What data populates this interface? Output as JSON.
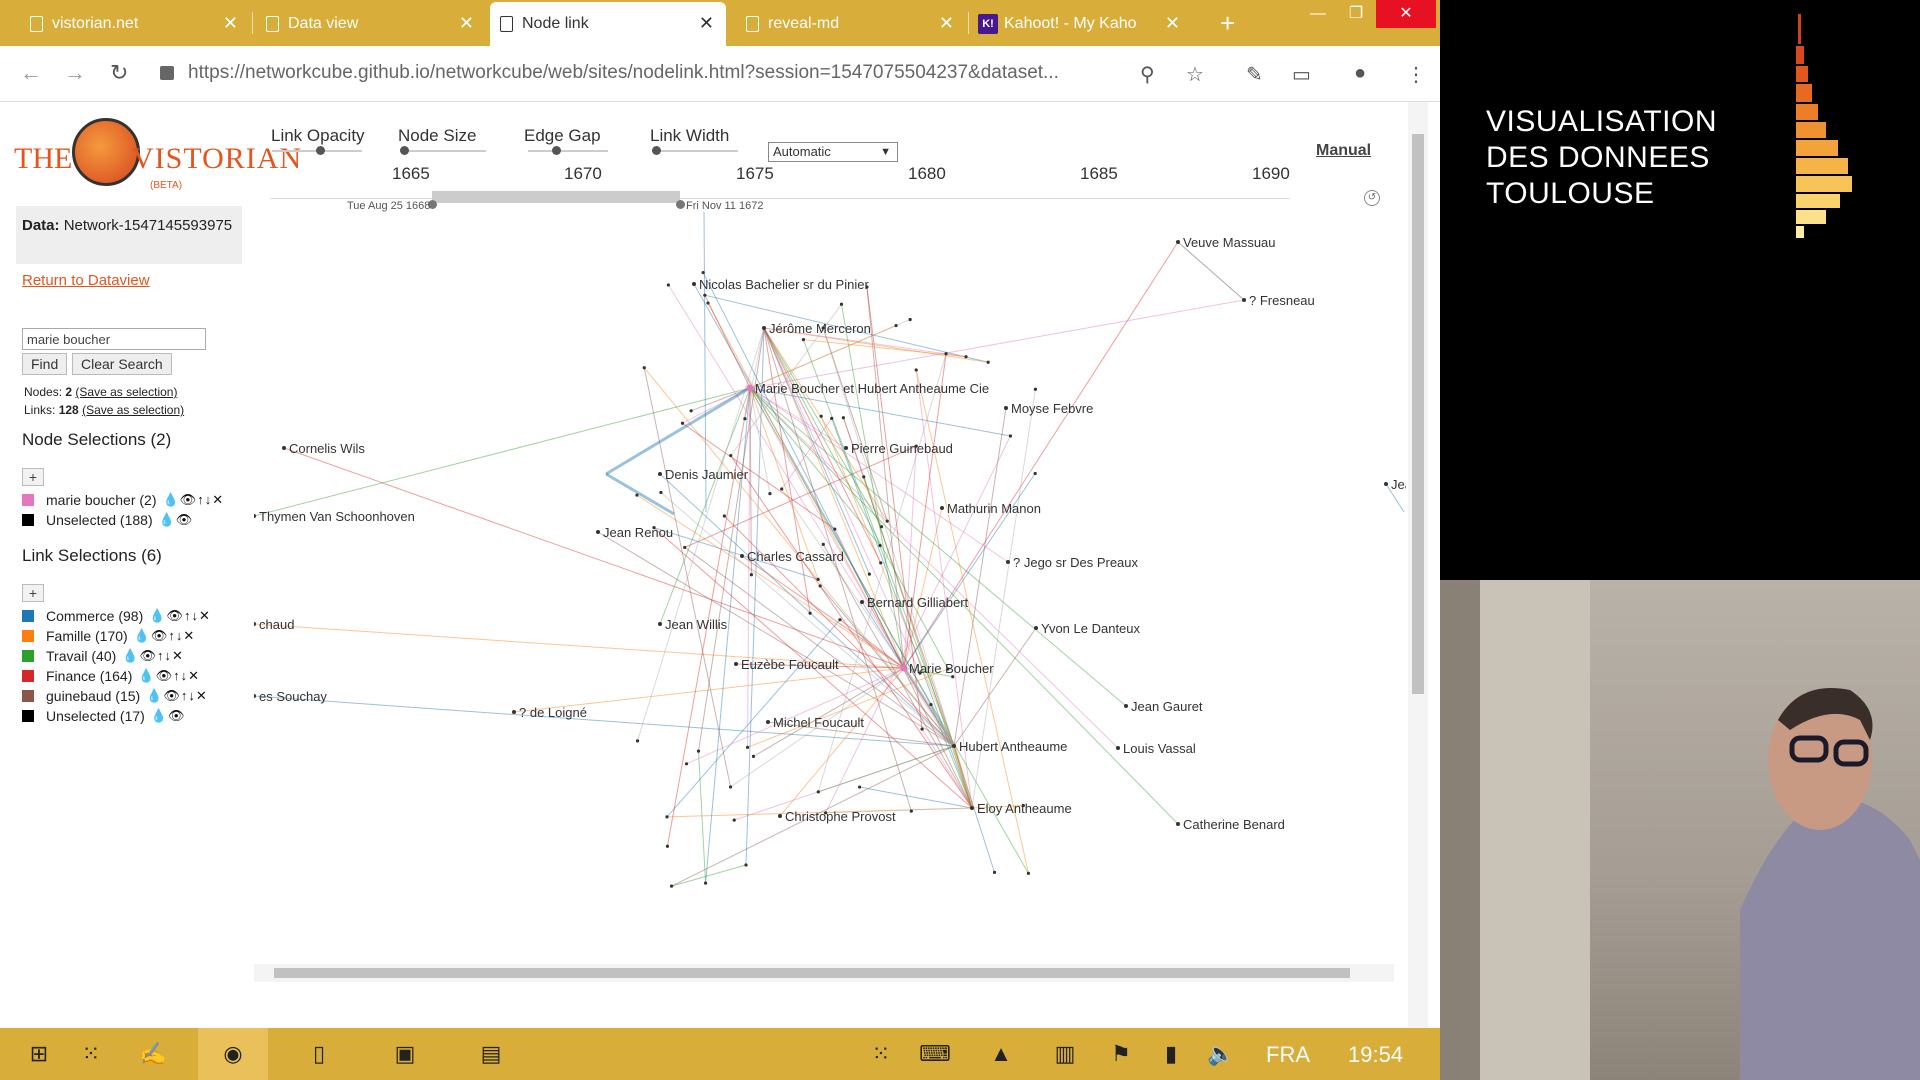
{
  "tabs": [
    {
      "label": "vistorian.net"
    },
    {
      "label": "Data view"
    },
    {
      "label": "Node link"
    },
    {
      "label": "reveal-md"
    },
    {
      "label": "Kahoot! - My Kaho"
    }
  ],
  "kahoot_icon": "K!",
  "address": {
    "url": "https://networkcube.github.io/networkcube/web/sites/nodelink.html?session=1547075504237&dataset..."
  },
  "logo": {
    "left": "THE",
    "right": "VISTORIAN",
    "beta": "(BETA)"
  },
  "sidebar": {
    "data_label": "Data:",
    "data_value": "Network-1547145593975",
    "return_link": "Return to Dataview",
    "search_value": "marie boucher",
    "find_label": "Find",
    "clear_label": "Clear Search",
    "nodes_prefix": "Nodes:",
    "nodes_count": "2",
    "links_prefix": "Links:",
    "links_count": "128",
    "save_link": "(Save as selection)",
    "node_selections_title": "Node Selections (2)",
    "node_selections": [
      {
        "label": "marie boucher (2)",
        "color": "#e377c2",
        "icons": "💧👁↑↓✕"
      },
      {
        "label": "Unselected (188)",
        "color": "#000000",
        "icons": "💧👁"
      }
    ],
    "link_selections_title": "Link Selections (6)",
    "link_selections": [
      {
        "label": "Commerce (98)",
        "color": "#1f77b4",
        "icons": "💧👁↑↓✕"
      },
      {
        "label": "Famille (170)",
        "color": "#ff7f0e",
        "icons": "💧👁↑↓✕"
      },
      {
        "label": "Travail (40)",
        "color": "#2ca02c",
        "icons": "💧👁↑↓✕"
      },
      {
        "label": "Finance (164)",
        "color": "#d62728",
        "icons": "💧👁↑↓✕"
      },
      {
        "label": "guinebaud (15)",
        "color": "#8c564b",
        "icons": "💧👁↑↓✕"
      },
      {
        "label": "Unselected (17)",
        "color": "#000000",
        "icons": "💧👁"
      }
    ]
  },
  "controls": {
    "link_opacity": "Link Opacity",
    "node_size": "Node Size",
    "edge_gap": "Edge Gap",
    "link_width": "Link Width",
    "layout_value": "Automatic",
    "manual": "Manual"
  },
  "timeline": {
    "years": [
      "1665",
      "1670",
      "1675",
      "1680",
      "1685",
      "1690"
    ],
    "start_label": "Tue Aug 25 1668",
    "end_label": "Fri Nov 11 1672"
  },
  "graph": {
    "nodes": [
      {
        "label": "Veuve Massuau"
      },
      {
        "label": "? Fresneau"
      },
      {
        "label": "Nicolas Bachelier sr du Pinier"
      },
      {
        "label": "Jérôme Merceron"
      },
      {
        "label": "Marie Boucher et Hubert Antheaume Cie"
      },
      {
        "label": "Moyse Febvre"
      },
      {
        "label": "Cornelis Wils"
      },
      {
        "label": "Pierre Guinebaud"
      },
      {
        "label": "Denis Jaumier"
      },
      {
        "label": "Mathurin Manon"
      },
      {
        "label": "Thymen Van Schoonhoven"
      },
      {
        "label": "Jean Renou"
      },
      {
        "label": "Charles Cassard"
      },
      {
        "label": "? Jego sr Des Preaux"
      },
      {
        "label": "Bernard Gilliabert"
      },
      {
        "label": "chaud"
      },
      {
        "label": "Jean Willis"
      },
      {
        "label": "Yvon Le Danteux"
      },
      {
        "label": "Euzèbe Foucault"
      },
      {
        "label": "Marie Boucher"
      },
      {
        "label": "es Souchay"
      },
      {
        "label": "? de Loigné"
      },
      {
        "label": "Jean Gauret"
      },
      {
        "label": "Michel Foucault"
      },
      {
        "label": "Hubert Antheaume"
      },
      {
        "label": "Louis Vassal"
      },
      {
        "label": "Eloy Antheaume"
      },
      {
        "label": "Christophe Provost"
      },
      {
        "label": "Catherine Benard"
      },
      {
        "label": "Jea"
      }
    ]
  },
  "taskbar": {
    "lang": "FRA",
    "clock": "19:54"
  },
  "slide": {
    "title": "VISUALISATION\nDES DONNEES\nTOULOUSE"
  },
  "colors": {
    "chrome": "#d8ad3a",
    "accent": "#e2561e"
  }
}
